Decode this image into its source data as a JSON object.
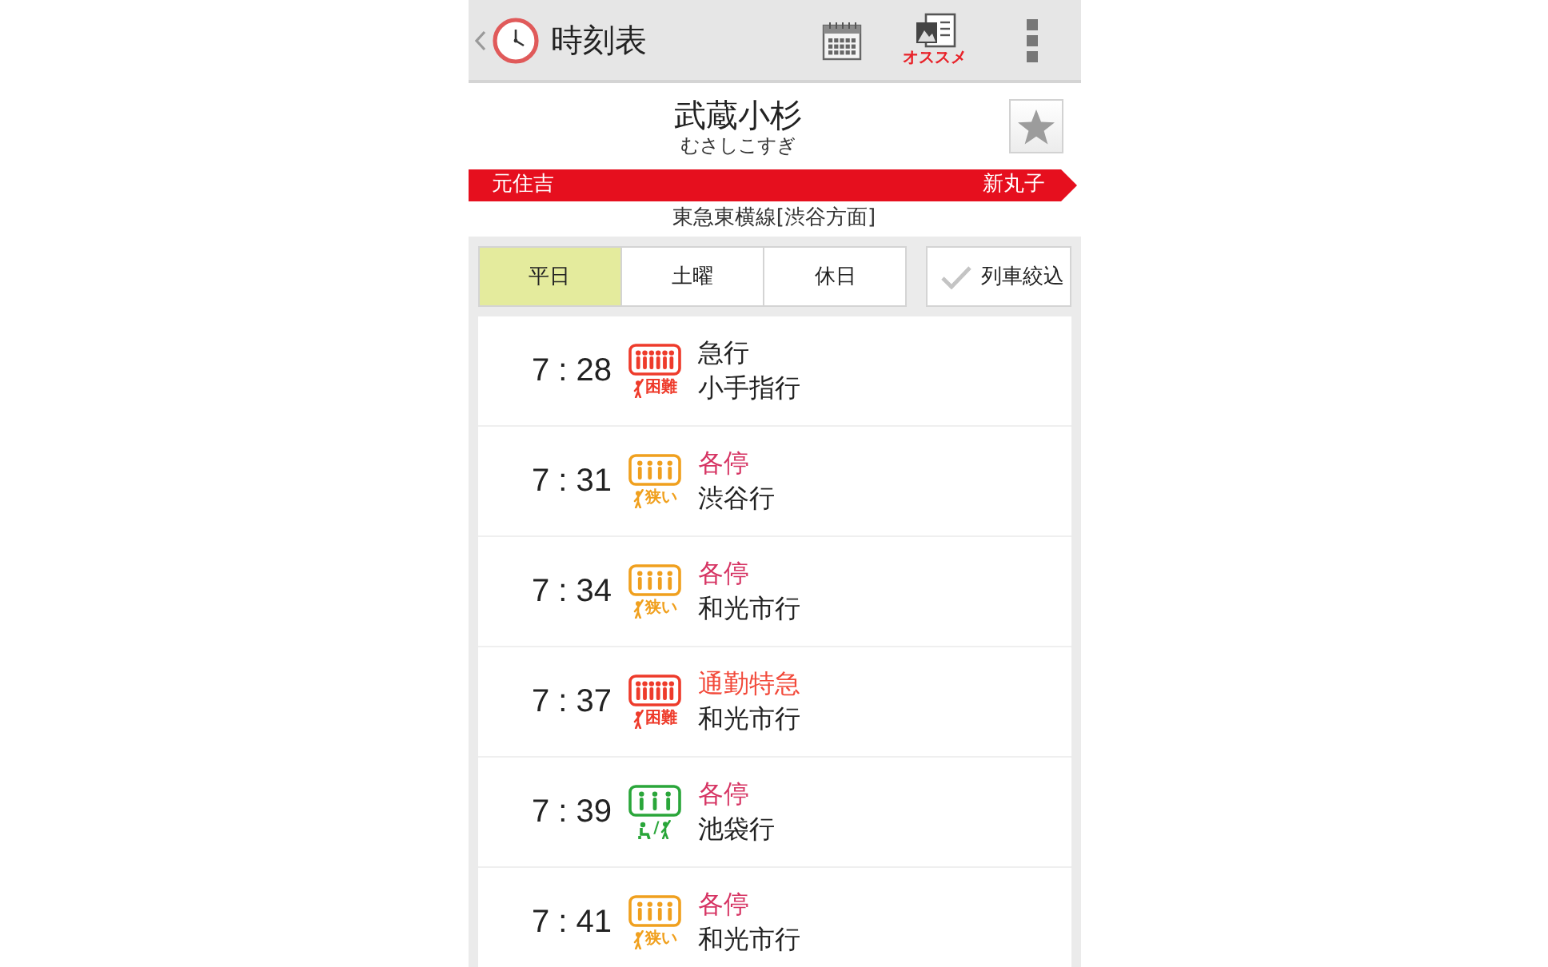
{
  "header": {
    "title": "時刻表",
    "recommend_label": "オススメ"
  },
  "station": {
    "name": "武蔵小杉",
    "reading": "むさしこすぎ",
    "favorite": false
  },
  "route": {
    "previous": "元住吉",
    "next": "新丸子",
    "line": "東急東横線[渋谷方面]"
  },
  "tabs": [
    {
      "label": "平日",
      "selected": true
    },
    {
      "label": "土曜",
      "selected": false
    },
    {
      "label": "休日",
      "selected": false
    }
  ],
  "filter": {
    "label": "列車絞込",
    "checked": false
  },
  "rows": [
    {
      "time": "7 : 28",
      "crowd": {
        "kind": "hard",
        "color": "#ee3b2b",
        "label": "困難"
      },
      "type": {
        "label": "急行",
        "color": "#222222"
      },
      "destination": "小手指行"
    },
    {
      "time": "7 : 31",
      "crowd": {
        "kind": "tight",
        "color": "#f0a01e",
        "label": "狭い"
      },
      "type": {
        "label": "各停",
        "color": "#d63463"
      },
      "destination": "渋谷行"
    },
    {
      "time": "7 : 34",
      "crowd": {
        "kind": "tight",
        "color": "#f0a01e",
        "label": "狭い"
      },
      "type": {
        "label": "各停",
        "color": "#d63463"
      },
      "destination": "和光市行"
    },
    {
      "time": "7 : 37",
      "crowd": {
        "kind": "hard",
        "color": "#ee3b2b",
        "label": "困難"
      },
      "type": {
        "label": "通勤特急",
        "color": "#f2493a"
      },
      "destination": "和光市行"
    },
    {
      "time": "7 : 39",
      "crowd": {
        "kind": "seated",
        "color": "#2aa63a",
        "label": "/"
      },
      "type": {
        "label": "各停",
        "color": "#d63463"
      },
      "destination": "池袋行"
    },
    {
      "time": "7 : 41",
      "crowd": {
        "kind": "tight",
        "color": "#f0a01e",
        "label": "狭い"
      },
      "type": {
        "label": "各停",
        "color": "#d63463"
      },
      "destination": "和光市行"
    }
  ]
}
